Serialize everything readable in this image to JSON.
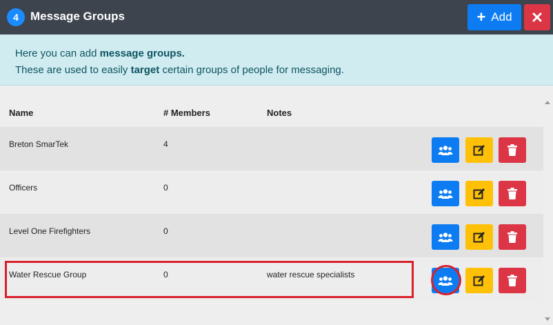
{
  "header": {
    "count": "4",
    "title": "Message Groups",
    "add_label": "Add"
  },
  "info": {
    "line1_prefix": "Here you can add ",
    "line1_bold": "message groups.",
    "line2_prefix": "These are used to easily ",
    "line2_bold": "target",
    "line2_suffix": " certain groups of people for messaging."
  },
  "table": {
    "headers": {
      "name": "Name",
      "members": "# Members",
      "notes": "Notes"
    },
    "rows": [
      {
        "name": "Breton SmarTek",
        "members": "4",
        "notes": ""
      },
      {
        "name": "Officers",
        "members": "0",
        "notes": ""
      },
      {
        "name": "Level One Firefighters",
        "members": "0",
        "notes": ""
      },
      {
        "name": "Water Rescue Group",
        "members": "0",
        "notes": "water rescue specialists"
      }
    ]
  },
  "icons": {
    "members": "users-icon",
    "edit": "edit-icon",
    "delete": "trash-icon",
    "add": "plus-icon",
    "close": "close-icon"
  },
  "colors": {
    "primary": "#0d7cf2",
    "warning": "#ffc107",
    "danger": "#dc3545",
    "header_bg": "#3d444e",
    "info_bg": "#d1ecf1",
    "highlight": "#d9202a"
  }
}
